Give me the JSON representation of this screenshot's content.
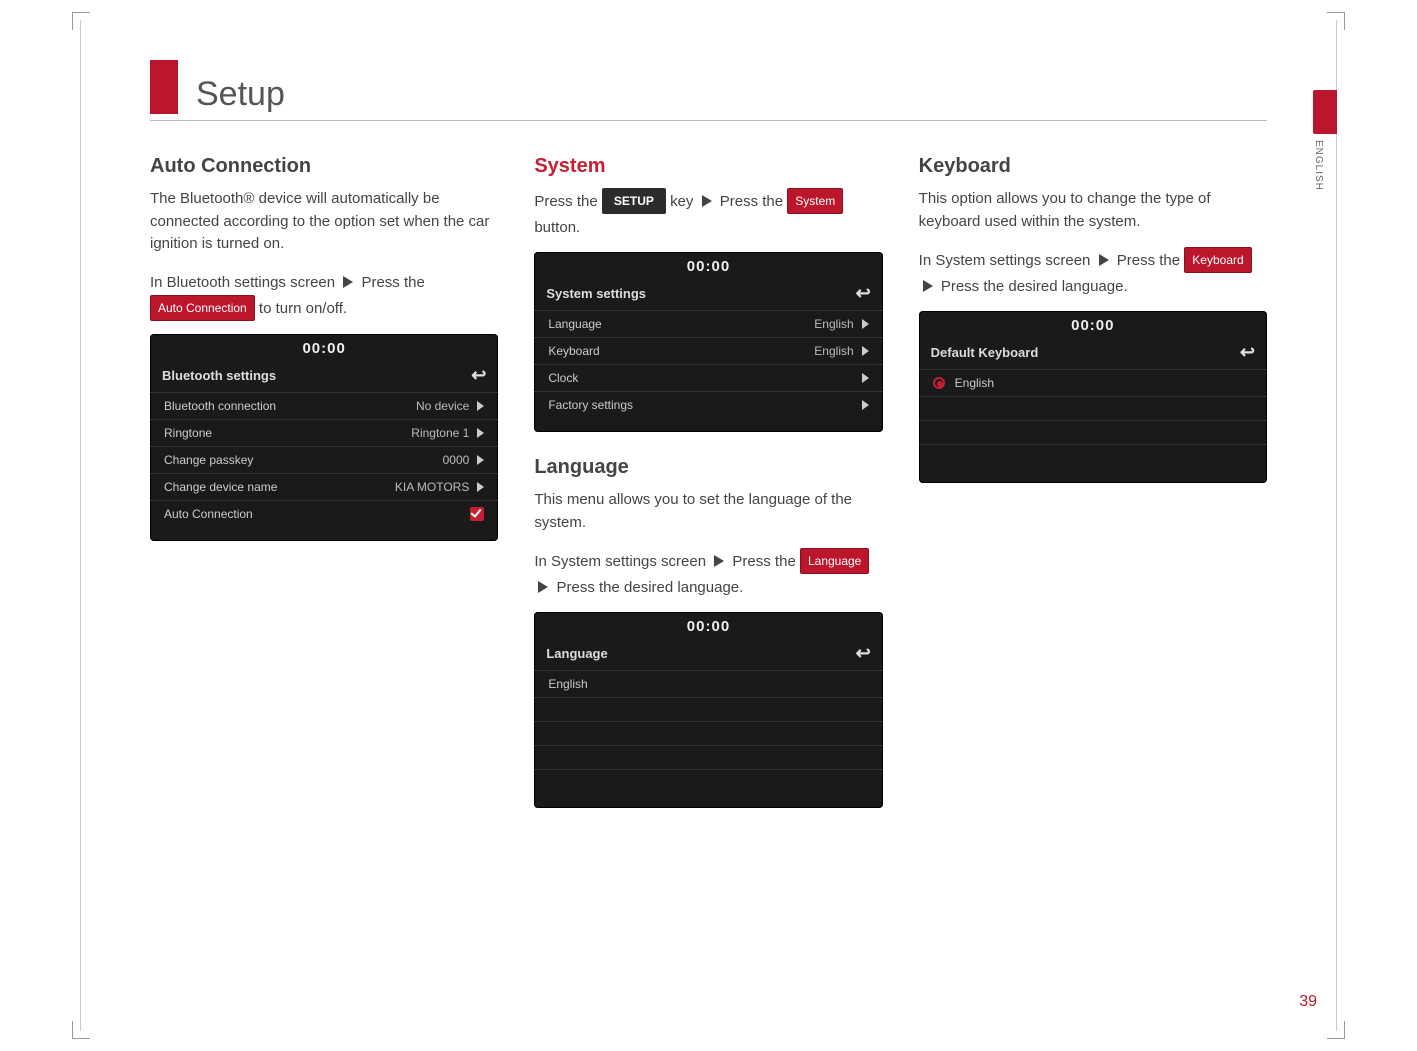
{
  "page": {
    "title": "Setup",
    "side_lang": "ENGLISH",
    "number": "39"
  },
  "col1": {
    "h1": "Auto Connection",
    "p1": "The Bluetooth® device will automatically be connected according to the option set when the car ignition is turned on.",
    "step_prefix": "In Bluetooth settings screen",
    "step_mid": "Press the",
    "btn": "Auto Connection",
    "step_suffix": "to turn on/off.",
    "device": {
      "time": "00:00",
      "title": "Bluetooth settings",
      "rows": [
        {
          "label": "Bluetooth connection",
          "value": "No device",
          "chev": true
        },
        {
          "label": "Ringtone",
          "value": "Ringtone 1",
          "chev": true
        },
        {
          "label": "Change passkey",
          "value": "0000",
          "chev": true
        },
        {
          "label": "Change device name",
          "value": "KIA MOTORS",
          "chev": true
        },
        {
          "label": "Auto Connection",
          "value_check": true
        }
      ]
    }
  },
  "col2": {
    "h1": "System",
    "step1_a": "Press the",
    "key": "SETUP",
    "step1_b": "key",
    "step1_c": "Press the",
    "btn1": "System",
    "step1_d": "button.",
    "device1": {
      "time": "00:00",
      "title": "System settings",
      "rows": [
        {
          "label": "Language",
          "value": "English",
          "chev": true
        },
        {
          "label": "Keyboard",
          "value": "English",
          "chev": true
        },
        {
          "label": "Clock",
          "value": "",
          "chev": true
        },
        {
          "label": "Factory settings",
          "value": "",
          "chev": true
        }
      ]
    },
    "h2": "Language",
    "p2": "This menu allows you to set the language of the system.",
    "step2_a": "In System settings screen",
    "step2_b": "Press the",
    "btn2": "Language",
    "step2_c": "Press the desired language.",
    "device2": {
      "time": "00:00",
      "title": "Language",
      "rows": [
        {
          "label": "English"
        }
      ]
    }
  },
  "col3": {
    "h1": "Keyboard",
    "p1": "This option allows you to change the type of keyboard used within the system.",
    "step_a": "In System settings screen",
    "step_b": "Press the",
    "btn": "Keyboard",
    "step_c": "Press the desired language.",
    "device": {
      "time": "00:00",
      "title": "Default Keyboard",
      "rows": [
        {
          "radio": true,
          "label": "English"
        }
      ]
    }
  }
}
